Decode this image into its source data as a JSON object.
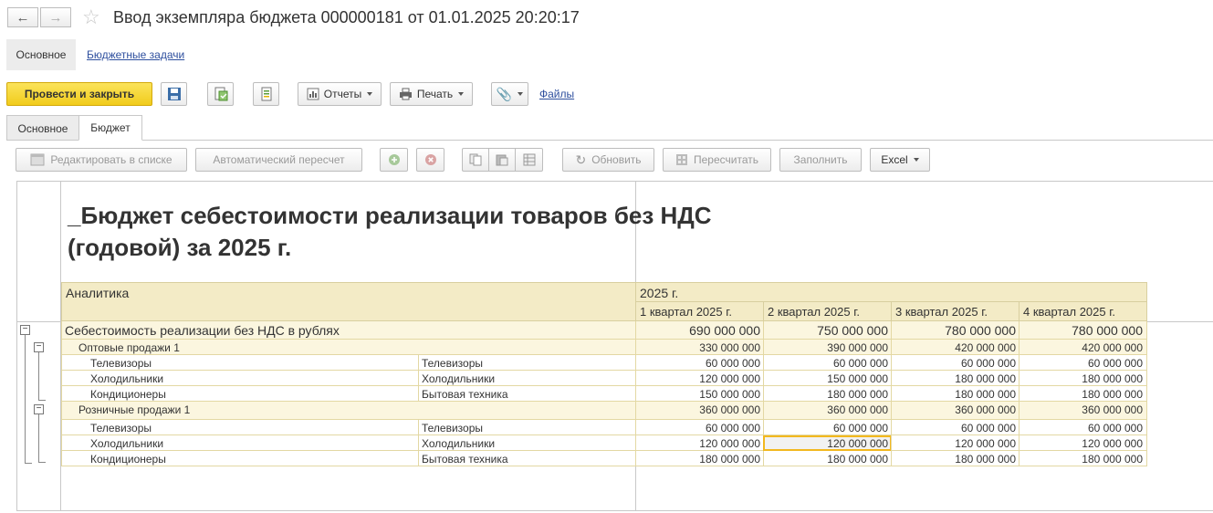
{
  "window": {
    "title": "Ввод экземпляра бюджета 000000181 от 01.01.2025 20:20:17"
  },
  "top_nav": {
    "active": "Основное",
    "link": "Бюджетные задачи"
  },
  "toolbar": {
    "post_close": "Провести и закрыть",
    "reports": "Отчеты",
    "print": "Печать",
    "files": "Файлы"
  },
  "tabs": [
    {
      "label": "Основное"
    },
    {
      "label": "Бюджет"
    }
  ],
  "sheet_toolbar": {
    "edit_list": "Редактировать в списке",
    "auto_recalc": "Автоматический пересчет",
    "refresh": "Обновить",
    "recalc": "Пересчитать",
    "fill": "Заполнить",
    "excel": "Excel"
  },
  "report": {
    "title_line1": "_Бюджет себестоимости реализации товаров без НДС",
    "title_line2": "(годовой) за 2025 г.",
    "header": {
      "analytics": "Аналитика",
      "year": "2025 г.",
      "quarters": [
        "1 квартал 2025 г.",
        "2 квартал 2025 г.",
        "3 квартал 2025 г.",
        "4 квартал 2025 г."
      ]
    },
    "rows": [
      {
        "name": "Себестоимость реализации без НДС в рублях",
        "analytic": "",
        "values": [
          "690 000 000",
          "750 000 000",
          "780 000 000",
          "780 000 000"
        ]
      },
      {
        "name": "Оптовые продажи 1",
        "analytic": "",
        "values": [
          "330 000 000",
          "390 000 000",
          "420 000 000",
          "420 000 000"
        ]
      },
      {
        "name": "Телевизоры",
        "analytic": "Телевизоры",
        "values": [
          "60 000 000",
          "60 000 000",
          "60 000 000",
          "60 000 000"
        ]
      },
      {
        "name": "Холодильники",
        "analytic": "Холодильники",
        "values": [
          "120 000 000",
          "150 000 000",
          "180 000 000",
          "180 000 000"
        ]
      },
      {
        "name": "Кондиционеры",
        "analytic": "Бытовая техника",
        "values": [
          "150 000 000",
          "180 000 000",
          "180 000 000",
          "180 000 000"
        ]
      },
      {
        "name": "Розничные  продажи 1",
        "analytic": "",
        "values": [
          "360 000 000",
          "360 000 000",
          "360 000 000",
          "360 000 000"
        ]
      },
      {
        "name": "Телевизоры",
        "analytic": "Телевизоры",
        "values": [
          "60 000 000",
          "60 000 000",
          "60 000 000",
          "60 000 000"
        ]
      },
      {
        "name": "Холодильники",
        "analytic": "Холодильники",
        "values": [
          "120 000 000",
          "120 000 000",
          "120 000 000",
          "120 000 000"
        ]
      },
      {
        "name": "Кондиционеры",
        "analytic": "Бытовая техника",
        "values": [
          "180 000 000",
          "180 000 000",
          "180 000 000",
          "180 000 000"
        ]
      }
    ]
  },
  "colors": {
    "accent": "#f5d83a",
    "header_bg": "#f3ebc6",
    "row_bg": "#fbf6df",
    "selected_border": "#f2b81f"
  }
}
